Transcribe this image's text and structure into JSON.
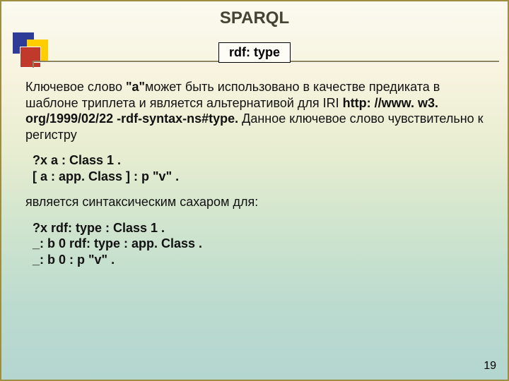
{
  "title": "SPARQL",
  "subtitle": "rdf: type",
  "para_prefix": "Ключевое слово ",
  "para_keyword": "\"a\"",
  "para_mid": "может быть использовано в качестве предиката в шаблоне триплета и является альтернативой для IRI ",
  "iri_bold": "http: //www. w3. org/1999/02/22 -rdf-syntax-ns#type. ",
  "para_tail": "Данное ключевое слово чувствительно к регистру",
  "code1": "?x a : Class 1 .\n[ a : app. Class ] : p \"v\" .",
  "mid_sentence": "является синтаксическим сахаром для:",
  "code2": "?x rdf: type : Class 1 .\n_: b 0 rdf: type : app. Class .\n_: b 0 : p \"v\" .",
  "page_number": "19"
}
